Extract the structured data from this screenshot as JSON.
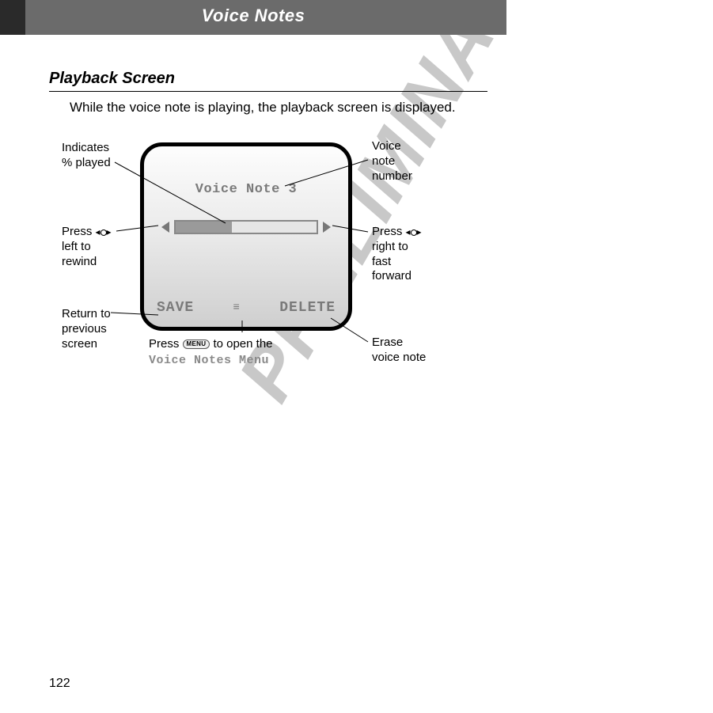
{
  "header": {
    "title": "Voice Notes"
  },
  "section": {
    "title": "Playback Screen",
    "description": "While the voice note is playing, the playback screen is displayed."
  },
  "screen": {
    "title": "Voice Note 3",
    "softkey_left": "SAVE",
    "softkey_right": "DELETE",
    "progress_percent": 40
  },
  "callouts": {
    "percent_played": "Indicates\n% played",
    "voice_note_number": "Voice\nnote\nnumber",
    "press_left_rewind_pre": "Press ",
    "press_left_rewind_post": "\nleft to\nrewind",
    "press_right_ff_pre": "Press ",
    "press_right_ff_post": "\nright to\nfast\nforward",
    "return_previous": "Return to\nprevious\nscreen",
    "erase_voice_note": "Erase\nvoice note",
    "bottom_press": "Press ",
    "bottom_open": " to open the",
    "bottom_menu_label": "Voice Notes Menu",
    "menu_key": "MENU"
  },
  "watermark": "PRELIMINARY",
  "page_number": "122"
}
